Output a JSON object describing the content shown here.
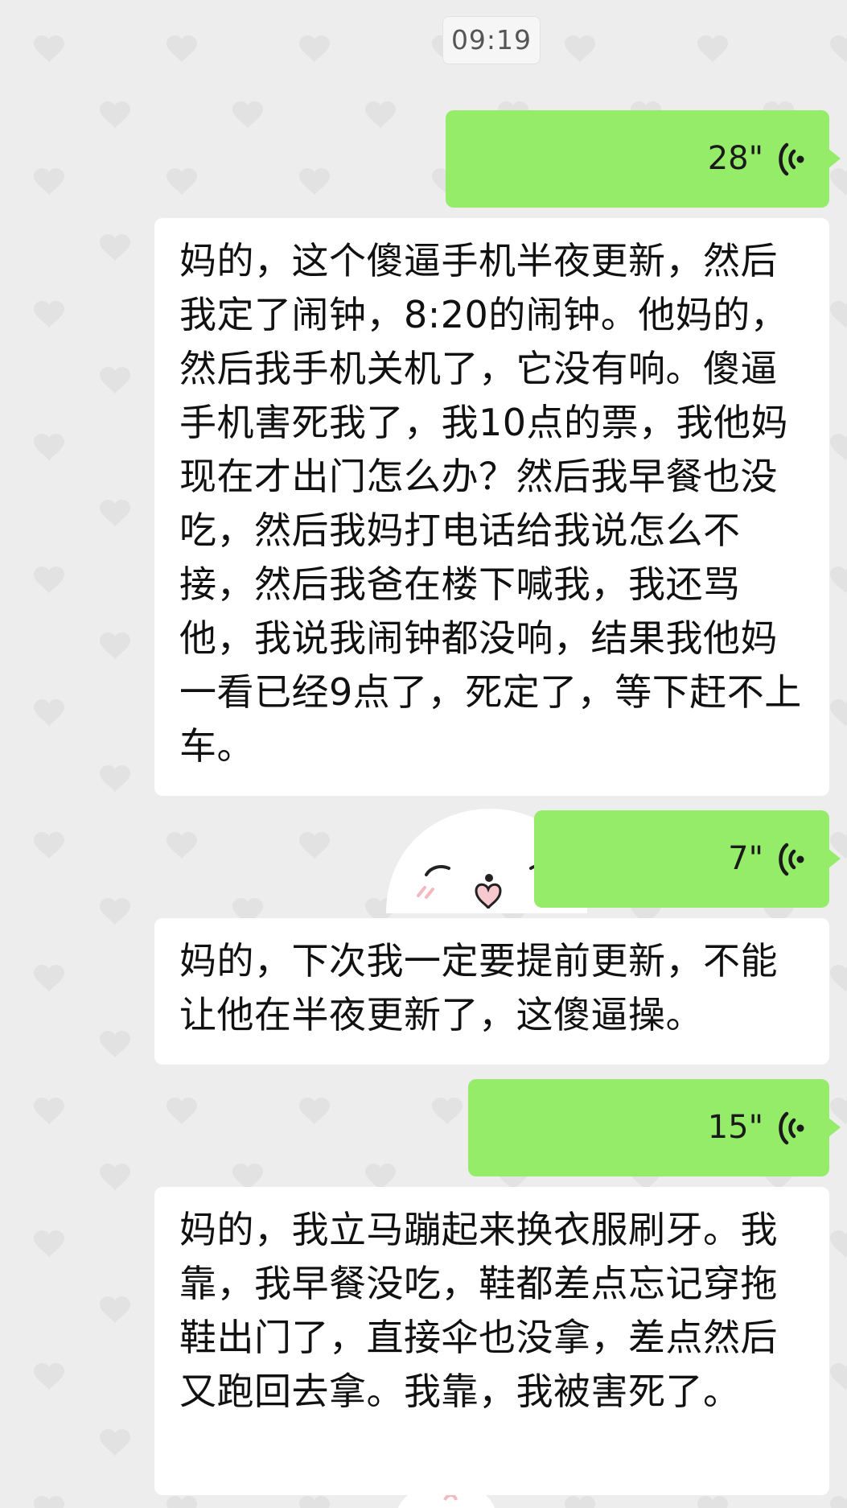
{
  "chat": {
    "timestamp": "09:19",
    "voice_messages": [
      {
        "duration": "28\"",
        "icon": "voice-wave-icon"
      },
      {
        "duration": "7\"",
        "icon": "voice-wave-icon"
      },
      {
        "duration": "15\"",
        "icon": "voice-wave-icon"
      }
    ],
    "transcripts": [
      "妈的，这个傻逼手机半夜更新，然后我定了闹钟，8:20的闹钟。他妈的，然后我手机关机了，它没有响。傻逼手机害死我了，我10点的票，我他妈现在才出门怎么办？然后我早餐也没吃，然后我妈打电话给我说怎么不接，然后我爸在楼下喊我，我还骂他，我说我闹钟都没响，结果我他妈一看已经9点了，死定了，等下赶不上车。",
      "妈的，下次我一定要提前更新，不能让他在半夜更新了，这傻逼操。",
      "妈的，我立马蹦起来换衣服刷牙。我靠，我早餐没吃，鞋都差点忘记穿拖鞋出门了，直接伞也没拿，差点然后又跑回去拿。我靠，我被害死了。"
    ]
  },
  "colors": {
    "background": "#ededed",
    "self_bubble": "#95ec69",
    "transcript_bubble": "#ffffff",
    "heart_pattern": "#e2e2e2"
  }
}
